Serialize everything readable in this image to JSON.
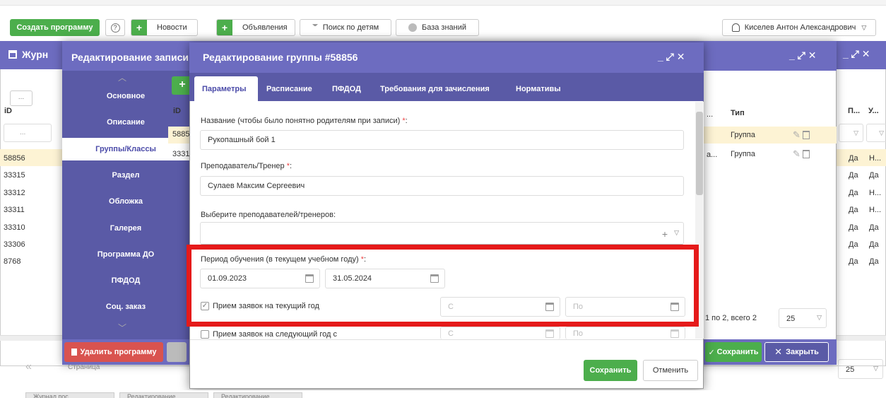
{
  "toolbar": {
    "create_program": "Создать программу",
    "help": "?",
    "plus": "+",
    "news": "Новости",
    "ads": "Объявления",
    "search_children": "Поиск по детям",
    "knowledge_base": "База знаний",
    "user_name": "Киселев Антон Александрович"
  },
  "journal": {
    "title": "Журн",
    "id_header": "iD",
    "filter_placeholder": "...",
    "ids": [
      "58856",
      "33315",
      "33312",
      "33311",
      "33310",
      "33306",
      "8768"
    ],
    "right_headers": [
      "П...",
      "У..."
    ],
    "right_values": [
      [
        "Да",
        "Н..."
      ],
      [
        "Да",
        "Да"
      ],
      [
        "Да",
        "Н..."
      ],
      [
        "Да",
        "Н..."
      ],
      [
        "Да",
        "Да"
      ],
      [
        "Да",
        "Да"
      ],
      [
        "Да",
        "Да"
      ]
    ],
    "page_size": "25"
  },
  "edit_record": {
    "title": "Редактирование записи",
    "sidebar": [
      "Основное",
      "Описание",
      "Группы/Классы",
      "Раздел",
      "Обложка",
      "Галерея",
      "Программа ДО",
      "ПФДОД",
      "Соц. заказ"
    ],
    "id_header": "iD",
    "rows": [
      "5885",
      "3331"
    ],
    "col_ellipsis": "...",
    "type_header": "Тип",
    "type_values": [
      "Группа",
      "Группа"
    ],
    "row_prefix": "а...",
    "pager_text": "1 по 2, всего 2",
    "page_size": "25",
    "page_label": "Страница",
    "delete_program": "Удалить программу",
    "save": "Сохранить",
    "close": "Закрыть"
  },
  "dialog": {
    "title": "Редактирование группы #58856",
    "tabs": [
      "Параметры",
      "Расписание",
      "ПФДОД",
      "Требования для зачисления",
      "Нормативы"
    ],
    "name_label": "Название (чтобы было понятно родителям при записи)",
    "name_value": "Рукопашный бой 1",
    "teacher_label": "Преподаватель/Тренер",
    "teacher_value": "Сулаев Максим Сергеевич",
    "teachers_label": "Выберите преподавателей/тренеров:",
    "period_label": "Период обучения (в текущем учебном году)",
    "date_from": "01.09.2023",
    "date_to": "31.05.2024",
    "accept_current": "Прием заявок на текущий год",
    "accept_next": "Прием заявок на следующий год с",
    "from_placeholder": "С",
    "to_placeholder": "По",
    "save": "Сохранить",
    "cancel": "Отменить"
  },
  "taskbar": [
    "Журнал пос...",
    "Редактирование...",
    "Редактирование..."
  ],
  "colors": {
    "header_purple": "#6d6cc0",
    "sidebar_purple": "#5a5aa6",
    "green": "#4cae4c",
    "red": "#d9534f",
    "highlight": "#e51a1a",
    "selected_row": "#fdf3d4"
  }
}
